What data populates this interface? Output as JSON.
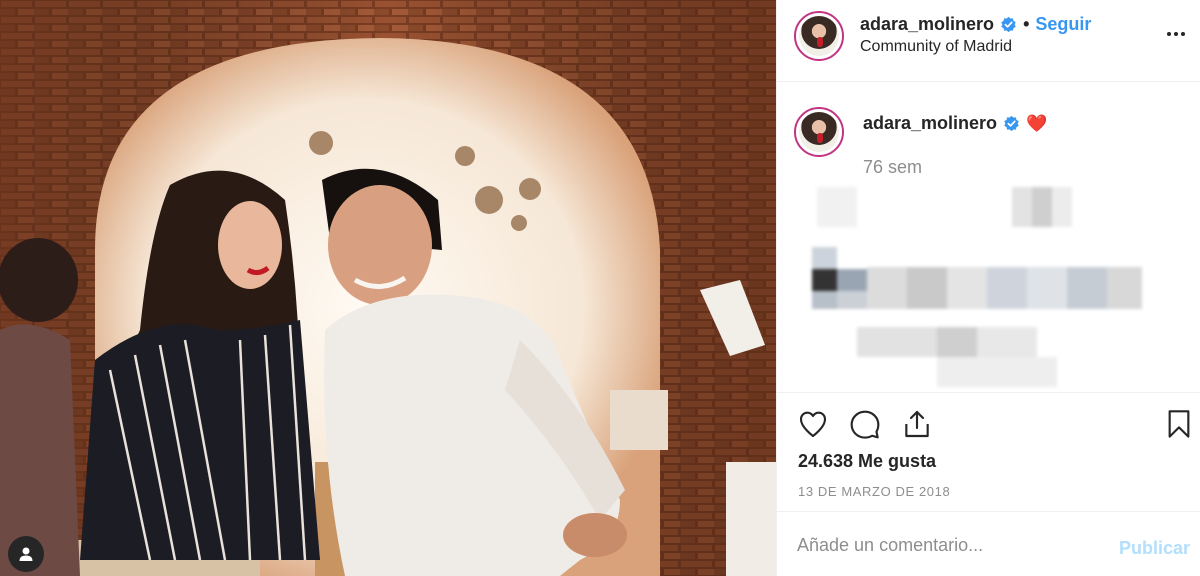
{
  "post": {
    "username": "adara_molinero",
    "location": "Community of Madrid",
    "separator": "•",
    "follow_label": "Seguir",
    "more_icon": "more-horizontal-icon"
  },
  "caption": {
    "username": "adara_molinero",
    "emoji": "❤️",
    "time_ago": "76 sem"
  },
  "engagement": {
    "likes_text": "24.638 Me gusta",
    "date_text": "13 DE MARZO DE 2018"
  },
  "comment_form": {
    "placeholder": "Añade un comentario...",
    "publish_label": "Publicar"
  },
  "colors": {
    "accent": "#3897f0",
    "verified": "#3897f0",
    "publish_disabled": "#b2dffc",
    "story_ring": "#c13584"
  },
  "icons": [
    "heart-icon",
    "comment-icon",
    "share-icon",
    "bookmark-icon",
    "verified-badge-icon",
    "user-tag-icon"
  ]
}
